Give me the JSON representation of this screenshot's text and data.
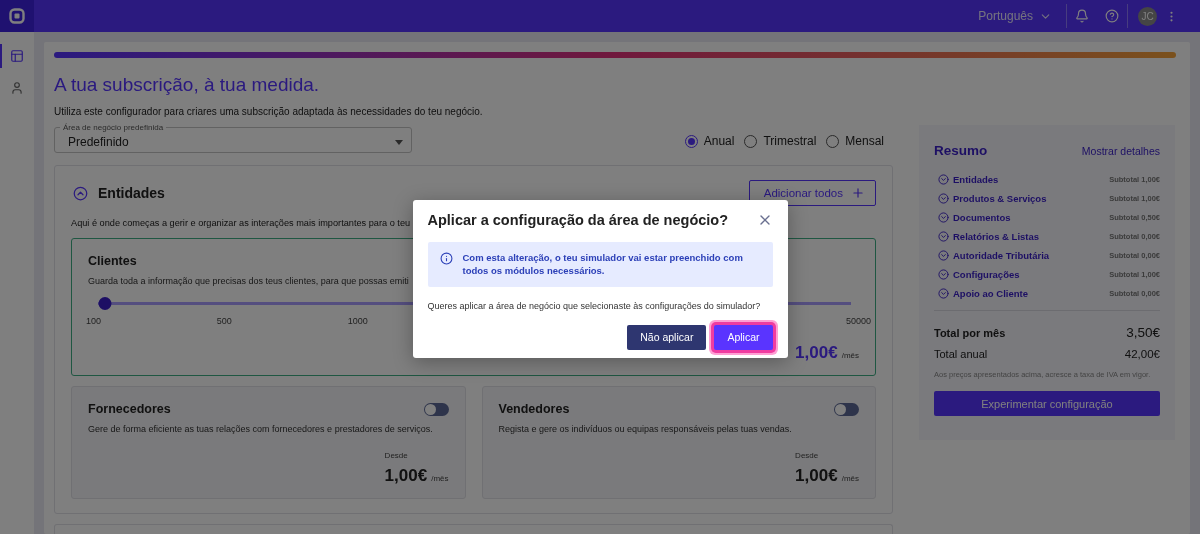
{
  "top_bar": {
    "language": "Português",
    "avatar": "JC"
  },
  "sidebar": {
    "items": [
      {
        "kind": "layout",
        "selected": true
      },
      {
        "kind": "profile",
        "selected": false
      }
    ]
  },
  "page": {
    "title": "A tua subscrição, à tua medida.",
    "subtitle": "Utiliza este configurador para criares uma subscrição adaptada às necessidades do teu negócio.",
    "business_area": {
      "label": "Área de negócio predefinida",
      "value": "Predefinido"
    },
    "billing": [
      {
        "label": "Anual",
        "selected": true
      },
      {
        "label": "Trimestral",
        "selected": false
      },
      {
        "label": "Mensal",
        "selected": false
      }
    ]
  },
  "section": {
    "title": "Entidades",
    "expanded": true,
    "add_all": "Adicionar todos",
    "description": "Aqui é onde começas a gerir e organizar as interações mais importantes para o teu",
    "modules": [
      {
        "kind": "slider",
        "title": "Clientes",
        "description": "Guarda toda a informação que precisas dos teus clientes, para que possas emiti",
        "active": true,
        "level": 0,
        "ticks": [
          "100",
          "500",
          "1000",
          "50000"
        ],
        "price": "1,00€",
        "unit": "/mês"
      },
      {
        "kind": "toggle",
        "title": "Fornecedores",
        "description": "Gere de forma eficiente as tuas relações com fornecedores e prestadores de serviços.",
        "active": false,
        "on": false,
        "from": "Desde",
        "price": "1,00€",
        "unit": "/mês"
      },
      {
        "kind": "toggle",
        "title": "Vendedores",
        "description": "Regista e gere os indivíduos ou equipas responsáveis pelas tuas vendas.",
        "active": false,
        "on": false,
        "from": "Desde",
        "price": "1,00€",
        "unit": "/mês"
      }
    ]
  },
  "summary": {
    "title": "Resumo",
    "details_link": "Mostrar detalhes",
    "items": [
      {
        "label": "Entidades",
        "subtotal": "Subtotal 1,00€",
        "expanded": false
      },
      {
        "label": "Produtos & Serviços",
        "subtotal": "Subtotal 1,00€",
        "expanded": false
      },
      {
        "label": "Documentos",
        "subtotal": "Subtotal 0,50€",
        "expanded": false
      },
      {
        "label": "Relatórios & Listas",
        "subtotal": "Subtotal 0,00€",
        "expanded": false
      },
      {
        "label": "Autoridade Tributária",
        "subtotal": "Subtotal 0,00€",
        "expanded": false
      },
      {
        "label": "Configurações",
        "subtotal": "Subtotal 1,00€",
        "expanded": false
      },
      {
        "label": "Apoio ao Cliente",
        "subtotal": "Subtotal 0,00€",
        "expanded": false
      }
    ],
    "total_month_label": "Total por mês",
    "total_month": "3,50€",
    "total_year_label": "Total anual",
    "total_year": "42,00€",
    "note": "Aos preços apresentados acima, acresce a taxa de IVA em vigor.",
    "button": "Experimentar configuração"
  },
  "dialog": {
    "title": "Aplicar a configuração da área de negócio?",
    "info": "Com esta alteração, o teu simulador vai estar preenchido com todos os módulos necessários.",
    "question": "Queres aplicar a área de negócio que selecionaste às configurações do simulador?",
    "buttons": [
      {
        "label": "Não aplicar",
        "kind": "secondary",
        "focused": false
      },
      {
        "label": "Aplicar",
        "kind": "primary",
        "focused": true
      }
    ]
  }
}
